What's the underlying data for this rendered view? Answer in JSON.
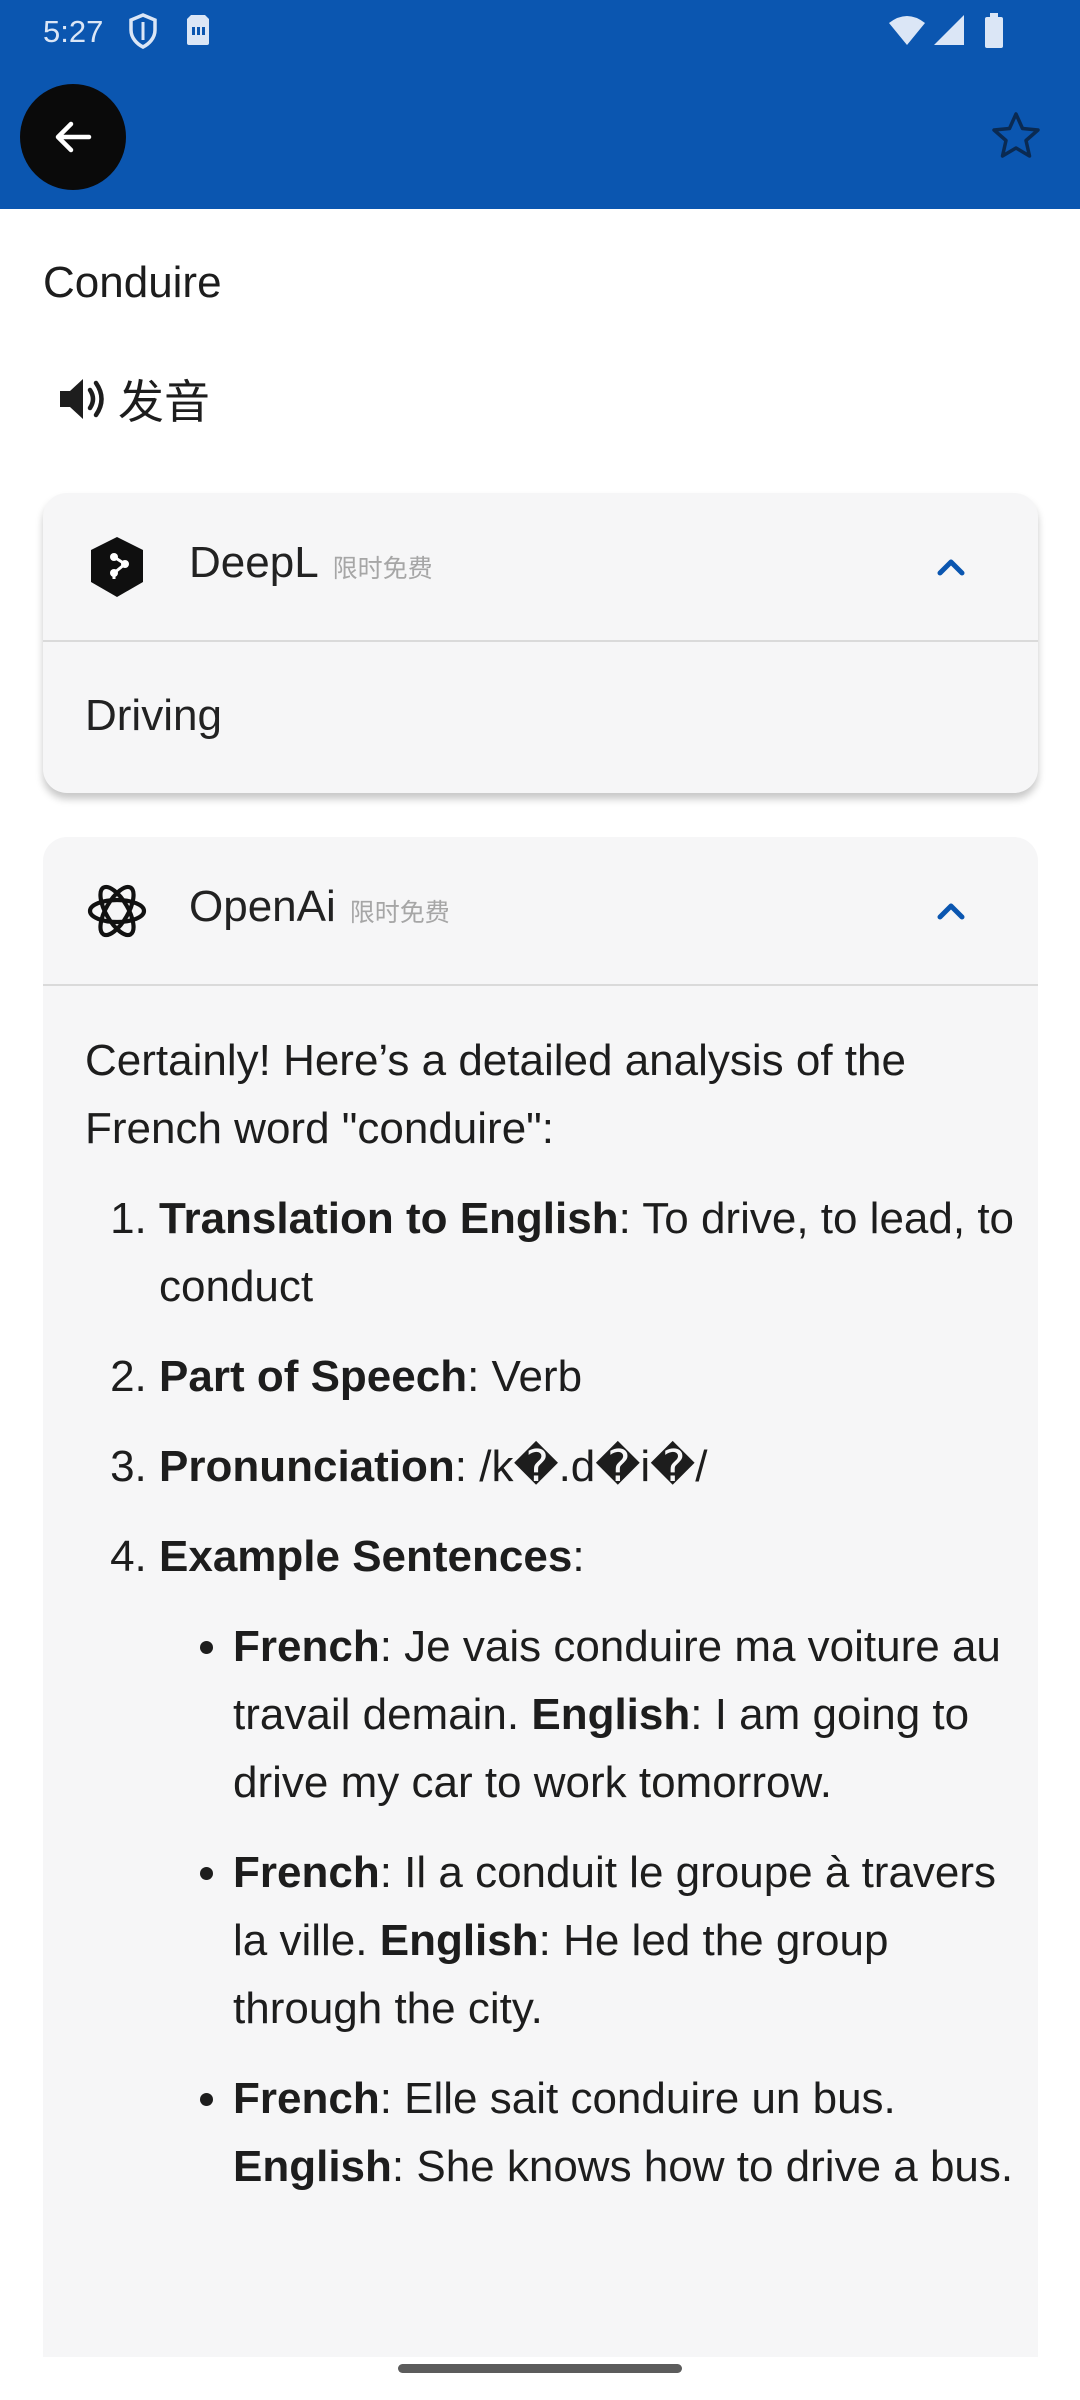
{
  "status_bar": {
    "time": "5:27"
  },
  "header": {
    "back_icon": "arrow-left-icon",
    "favorite_icon": "star-outline-icon"
  },
  "word": "Conduire",
  "pronounce": {
    "icon": "speaker-icon",
    "label": "发音"
  },
  "colors": {
    "app_bar": "#0b56b0",
    "accent": "#0b56b0",
    "card_bg": "#f6f6f7"
  },
  "providers": [
    {
      "name": "DeepL",
      "tag": "限时免费",
      "icon": "deepl-logo-icon",
      "expanded": true,
      "result": "Driving"
    },
    {
      "name": "OpenAi",
      "tag": "限时免费",
      "icon": "openai-logo-icon",
      "expanded": true,
      "intro": "Certainly! Here’s a detailed analysis of the French word \"conduire\":",
      "items": [
        {
          "label": "Translation to English",
          "text": ": To drive, to lead, to conduct"
        },
        {
          "label": "Part of Speech",
          "text": ": Verb"
        },
        {
          "label": "Pronunciation",
          "text": ": /k�.d�i�/"
        },
        {
          "label": "Example Sentences",
          "text": ":"
        }
      ],
      "examples": [
        {
          "fr_label": "French",
          "fr": ": Je vais conduire ma voiture au travail demain. ",
          "en_label": "English",
          "en": ": I am going to drive my car to work tomorrow."
        },
        {
          "fr_label": "French",
          "fr": ": Il a conduit le groupe à travers la ville. ",
          "en_label": "English",
          "en": ": He led the group through the city."
        },
        {
          "fr_label": "French",
          "fr": ": Elle sait conduire un bus. ",
          "en_label": "English",
          "en": ": She knows how to drive a bus."
        }
      ]
    }
  ]
}
